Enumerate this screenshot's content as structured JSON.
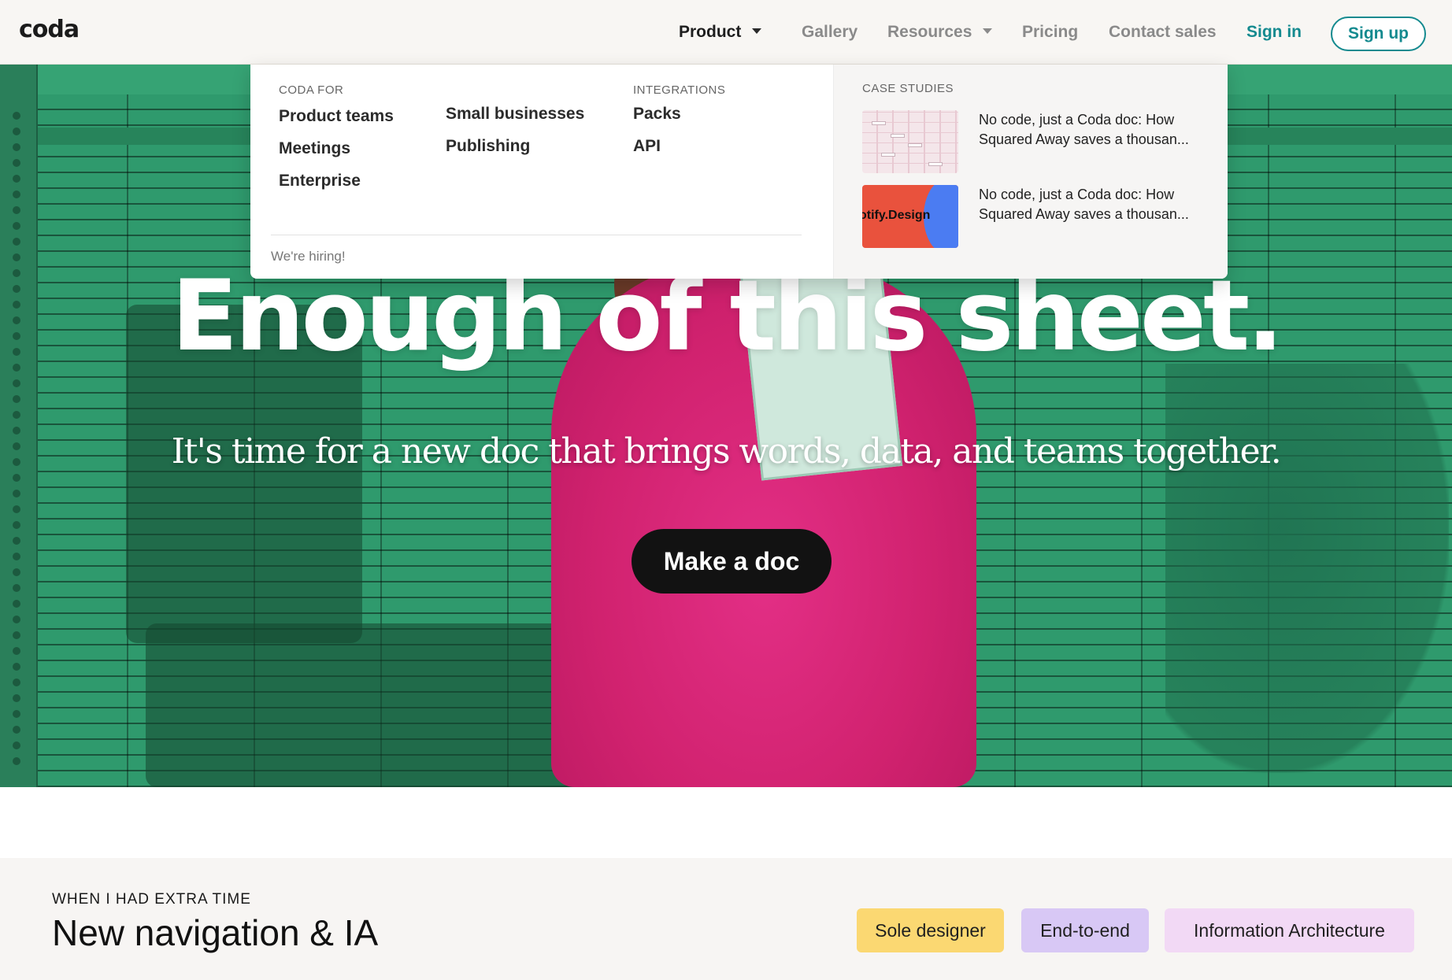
{
  "nav": {
    "logo": "coda",
    "product": "Product",
    "gallery": "Gallery",
    "resources": "Resources",
    "pricing": "Pricing",
    "contact_sales": "Contact sales",
    "sign_in": "Sign in",
    "sign_up": "Sign up"
  },
  "dropdown": {
    "coda_for_heading": "CODA FOR",
    "coda_for": [
      "Product teams",
      "Meetings",
      "Enterprise"
    ],
    "other": [
      "Small businesses",
      "Publishing"
    ],
    "integrations_heading": "INTEGRATIONS",
    "integrations": [
      "Packs",
      "API"
    ],
    "hiring": "We're hiring!",
    "case_studies_heading": "CASE STUDIES",
    "case_studies": [
      {
        "title": "No code, just a Coda doc: How Squared Away saves a thousan..."
      },
      {
        "title": "No code, just a Coda doc: How Squared Away saves a thousan...",
        "thumb_text": "otify.Design"
      }
    ]
  },
  "hero": {
    "title": "Enough of this sheet.",
    "subtitle": "It's time for a new doc that brings words, data, and teams together.",
    "cta": "Make a doc"
  },
  "section": {
    "kicker": "WHEN I HAD EXTRA TIME",
    "title": "New navigation & IA",
    "tags": [
      "Sole designer",
      "End-to-end",
      "Information Architecture"
    ]
  },
  "colors": {
    "accent_teal": "#148a8f",
    "hero_green": "#2f9a6d",
    "tag_yellow": "#fbd872",
    "tag_purple": "#d8c8f5",
    "tag_pink": "#f2d9f5"
  }
}
